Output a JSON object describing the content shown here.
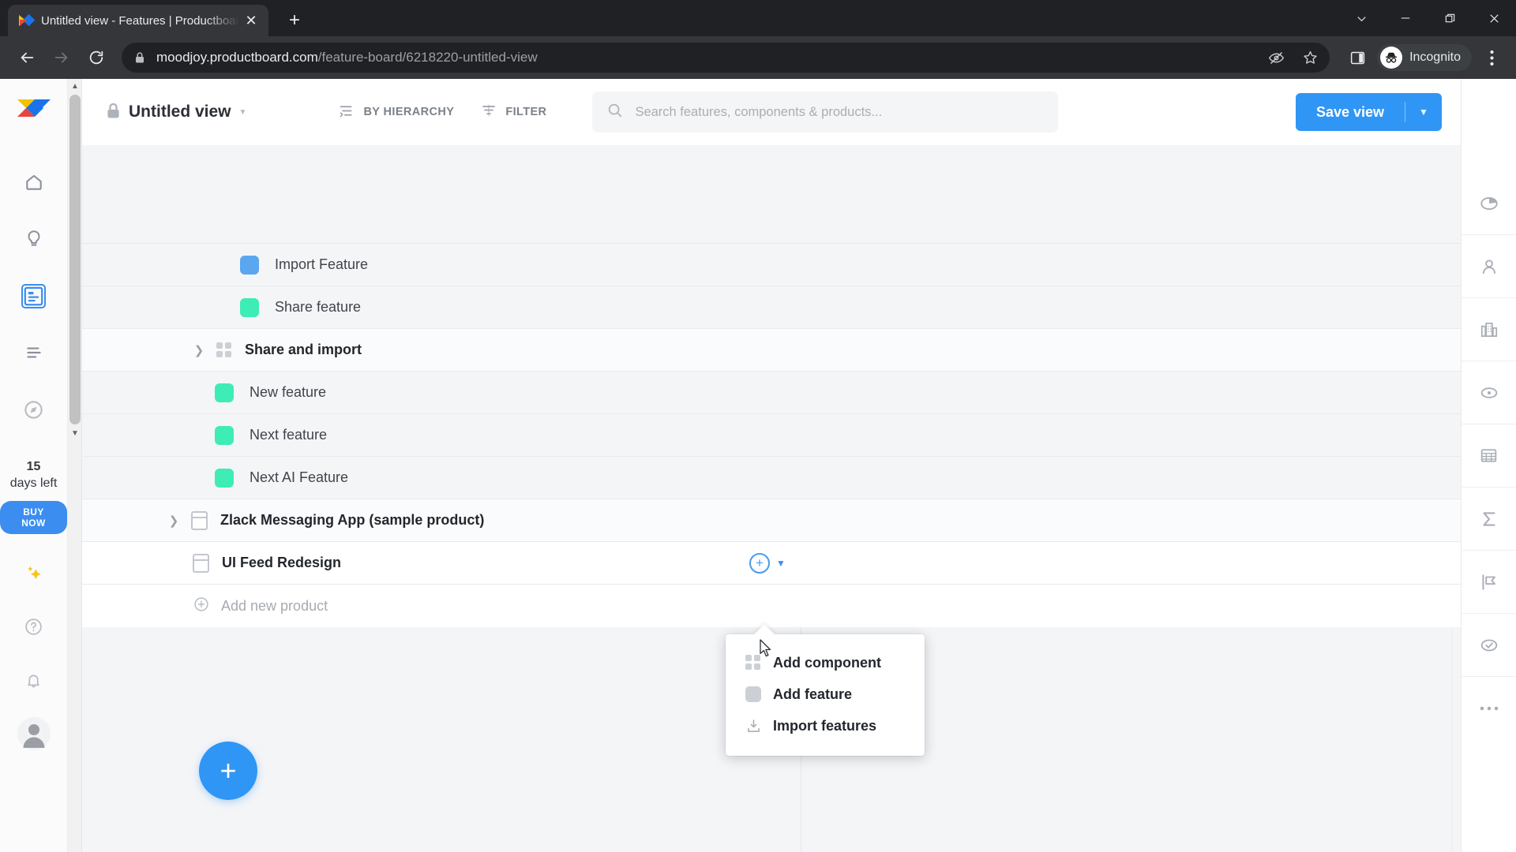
{
  "browser": {
    "tab": {
      "title": "Untitled view - Features | Productboard",
      "favicon": "productboard-logo-icon",
      "close": "close-icon"
    },
    "new_tab_label": "+",
    "window_controls": [
      "tab-search-icon",
      "minimize-icon",
      "maximize-icon",
      "close-window-icon"
    ],
    "nav": {
      "back": "back-icon",
      "forward": "forward-icon",
      "reload": "reload-icon"
    },
    "url": {
      "lock": "lock-icon",
      "host": "moodjoy.productboard.com",
      "path": "/feature-board/6218220-untitled-view"
    },
    "omnibox_actions": [
      "tracking-protection-icon",
      "bookmark-star-icon"
    ],
    "toolbar_right": {
      "side_panel": "side-panel-icon",
      "profile_label": "Incognito",
      "profile_icon": "incognito-hat-icon",
      "menu": "three-dot-menu-icon"
    }
  },
  "sidebar": {
    "logo": "productboard-logo",
    "items": [
      {
        "name": "home",
        "icon": "home-icon",
        "active": false
      },
      {
        "name": "insights",
        "icon": "lightbulb-icon",
        "active": false
      },
      {
        "name": "features",
        "icon": "features-board-icon",
        "active": true
      },
      {
        "name": "roadmaps",
        "icon": "roadmap-lines-icon",
        "active": false
      },
      {
        "name": "portal",
        "icon": "compass-icon",
        "active": false
      }
    ],
    "trial": {
      "days": "15",
      "label": "days left",
      "cta": "BUY NOW"
    },
    "bottom": [
      {
        "name": "ai-sparkle",
        "icon": "sparkle-icon"
      },
      {
        "name": "help",
        "icon": "question-circle-icon"
      },
      {
        "name": "notifications",
        "icon": "bell-icon"
      },
      {
        "name": "account",
        "icon": "avatar-icon"
      }
    ]
  },
  "header": {
    "lock_icon": "lock-icon",
    "view_title": "Untitled view",
    "view_caret": "chevron-down-icon",
    "tools": [
      {
        "label": "BY HIERARCHY",
        "icon": "hierarchy-icon"
      },
      {
        "label": "FILTER",
        "icon": "filter-icon"
      }
    ],
    "search": {
      "icon": "search-icon",
      "placeholder": "Search features, components & products...",
      "value": ""
    },
    "save": {
      "label": "Save view",
      "caret": "chevron-down-icon"
    }
  },
  "board": {
    "rows": [
      {
        "type": "feature",
        "label": "Import Feature",
        "color": "#5aa7f0",
        "indent": 200,
        "bg": "plain"
      },
      {
        "type": "feature",
        "label": "Share feature",
        "color": "#3eecb6",
        "indent": 200,
        "bg": "plain"
      },
      {
        "type": "component",
        "label": "Share and import",
        "indent": 140,
        "bg": "alt",
        "chevron": "chevron-right-icon",
        "icon": "component-grid-icon"
      },
      {
        "type": "feature",
        "label": "New feature",
        "color": "#3eecb6",
        "indent": 168,
        "bg": "plain"
      },
      {
        "type": "feature",
        "label": "Next feature",
        "color": "#3eecb6",
        "indent": 168,
        "bg": "plain"
      },
      {
        "type": "feature",
        "label": "Next AI Feature",
        "color": "#3eecb6",
        "indent": 168,
        "bg": "plain"
      },
      {
        "type": "product",
        "label": "Zlack Messaging App (sample product)",
        "indent": 108,
        "bg": "alt",
        "chevron": "chevron-right-icon",
        "icon": "product-card-icon"
      },
      {
        "type": "product",
        "label": "UI Feed Redesign",
        "indent": 140,
        "bg": "white",
        "icon": "product-card-icon",
        "add": true
      },
      {
        "type": "add",
        "label": "Add new product",
        "indent": 140,
        "bg": "white",
        "icon": "plus-circle-icon"
      }
    ],
    "add_buttons": {
      "plus": "plus-circle-icon",
      "caret": "chevron-down-icon"
    },
    "fab": {
      "label": "+",
      "icon": "plus-icon"
    }
  },
  "context_menu": {
    "items": [
      {
        "label": "Add component",
        "icon": "component-grid-icon"
      },
      {
        "label": "Add feature",
        "icon": "feature-square-icon"
      },
      {
        "label": "Import features",
        "icon": "import-download-icon"
      }
    ]
  },
  "right_rail": {
    "items": [
      {
        "name": "pie-chart",
        "icon": "pie-chart-icon"
      },
      {
        "name": "users",
        "icon": "person-icon"
      },
      {
        "name": "companies",
        "icon": "building-icon"
      },
      {
        "name": "objectives",
        "icon": "target-icon"
      },
      {
        "name": "table",
        "icon": "table-grid-icon"
      },
      {
        "name": "sum",
        "icon": "sigma-icon"
      },
      {
        "name": "milestones",
        "icon": "flag-icon"
      },
      {
        "name": "status",
        "icon": "check-circle-icon"
      },
      {
        "name": "more",
        "icon": "ellipsis-icon"
      }
    ]
  },
  "colors": {
    "accent": "#2f96f6",
    "feature_blue": "#5aa7f0",
    "feature_green": "#3eecb6",
    "board_bg": "#f4f5f7",
    "chrome_dark": "#202124"
  }
}
